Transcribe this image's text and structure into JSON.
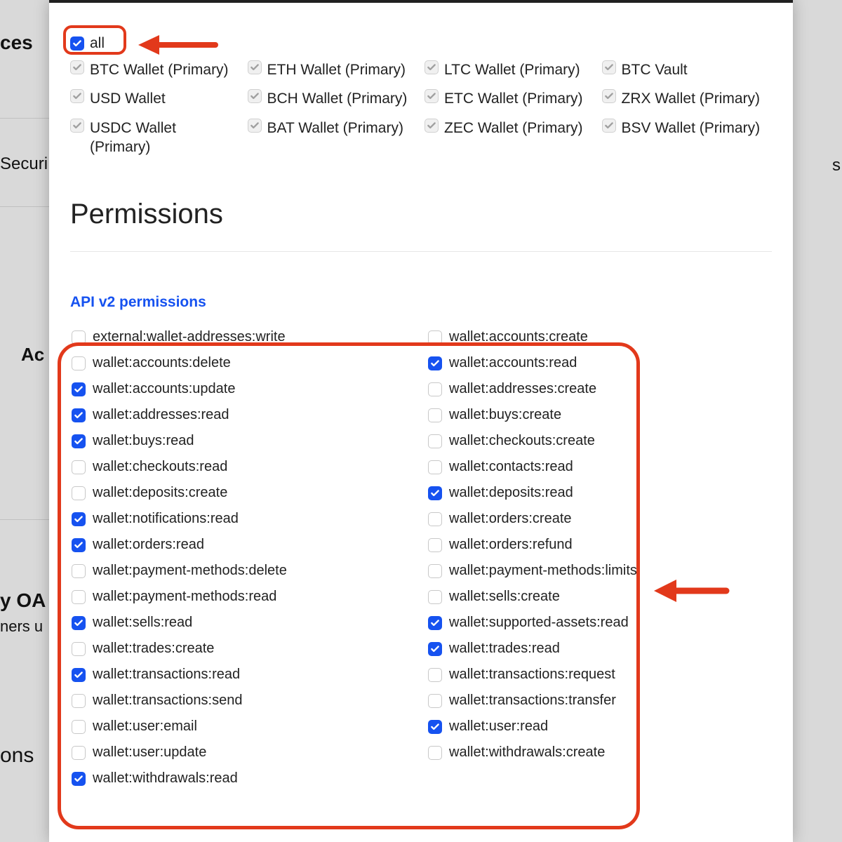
{
  "background": {
    "ces": "ces",
    "securi": "Securi",
    "ac": "Ac",
    "oauth": "y OA",
    "ners": "ners u",
    "ons": "ons",
    "s": "s"
  },
  "wallets": {
    "all_label": "all",
    "items": [
      "BTC Wallet (Primary)",
      "ETH Wallet (Primary)",
      "LTC Wallet (Primary)",
      "BTC Vault",
      "USD Wallet",
      "BCH Wallet (Primary)",
      "ETC Wallet (Primary)",
      "ZRX Wallet (Primary)",
      "USDC Wallet (Primary)",
      "BAT Wallet (Primary)",
      "ZEC Wallet (Primary)",
      "BSV Wallet (Primary)"
    ]
  },
  "permissions_title": "Permissions",
  "api_section_title": "API v2 permissions",
  "permissions": [
    {
      "label": "external:wallet-addresses:write",
      "checked": false
    },
    {
      "label": "wallet:accounts:create",
      "checked": false
    },
    {
      "label": "wallet:accounts:delete",
      "checked": false
    },
    {
      "label": "wallet:accounts:read",
      "checked": true
    },
    {
      "label": "wallet:accounts:update",
      "checked": true
    },
    {
      "label": "wallet:addresses:create",
      "checked": false
    },
    {
      "label": "wallet:addresses:read",
      "checked": true
    },
    {
      "label": "wallet:buys:create",
      "checked": false
    },
    {
      "label": "wallet:buys:read",
      "checked": true
    },
    {
      "label": "wallet:checkouts:create",
      "checked": false
    },
    {
      "label": "wallet:checkouts:read",
      "checked": false
    },
    {
      "label": "wallet:contacts:read",
      "checked": false
    },
    {
      "label": "wallet:deposits:create",
      "checked": false
    },
    {
      "label": "wallet:deposits:read",
      "checked": true
    },
    {
      "label": "wallet:notifications:read",
      "checked": true
    },
    {
      "label": "wallet:orders:create",
      "checked": false
    },
    {
      "label": "wallet:orders:read",
      "checked": true
    },
    {
      "label": "wallet:orders:refund",
      "checked": false
    },
    {
      "label": "wallet:payment-methods:delete",
      "checked": false
    },
    {
      "label": "wallet:payment-methods:limits",
      "checked": false
    },
    {
      "label": "wallet:payment-methods:read",
      "checked": false
    },
    {
      "label": "wallet:sells:create",
      "checked": false
    },
    {
      "label": "wallet:sells:read",
      "checked": true
    },
    {
      "label": "wallet:supported-assets:read",
      "checked": true
    },
    {
      "label": "wallet:trades:create",
      "checked": false
    },
    {
      "label": "wallet:trades:read",
      "checked": true
    },
    {
      "label": "wallet:transactions:read",
      "checked": true
    },
    {
      "label": "wallet:transactions:request",
      "checked": false
    },
    {
      "label": "wallet:transactions:send",
      "checked": false
    },
    {
      "label": "wallet:transactions:transfer",
      "checked": false
    },
    {
      "label": "wallet:user:email",
      "checked": false
    },
    {
      "label": "wallet:user:read",
      "checked": true
    },
    {
      "label": "wallet:user:update",
      "checked": false
    },
    {
      "label": "wallet:withdrawals:create",
      "checked": false
    },
    {
      "label": "wallet:withdrawals:read",
      "checked": true
    }
  ]
}
